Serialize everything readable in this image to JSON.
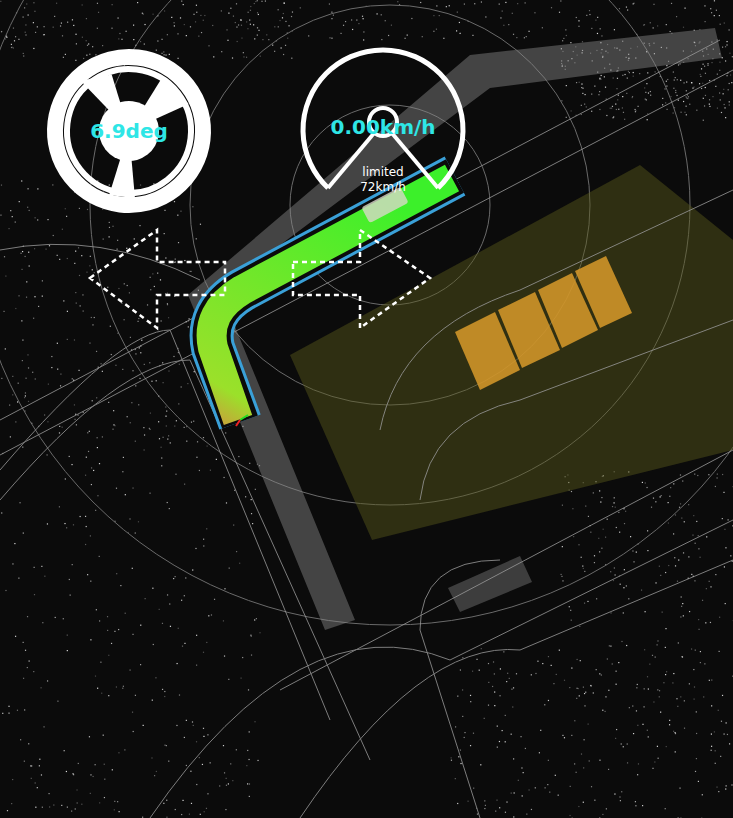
{
  "steering": {
    "angle": "6.9deg"
  },
  "speed": {
    "value": "0.00km/h",
    "limit_label": "limited",
    "limit_value": "72km/h",
    "level": 0
  },
  "turn_signals": [
    {
      "direction": "left",
      "on": false
    },
    {
      "direction": "right",
      "on": false
    }
  ]
}
